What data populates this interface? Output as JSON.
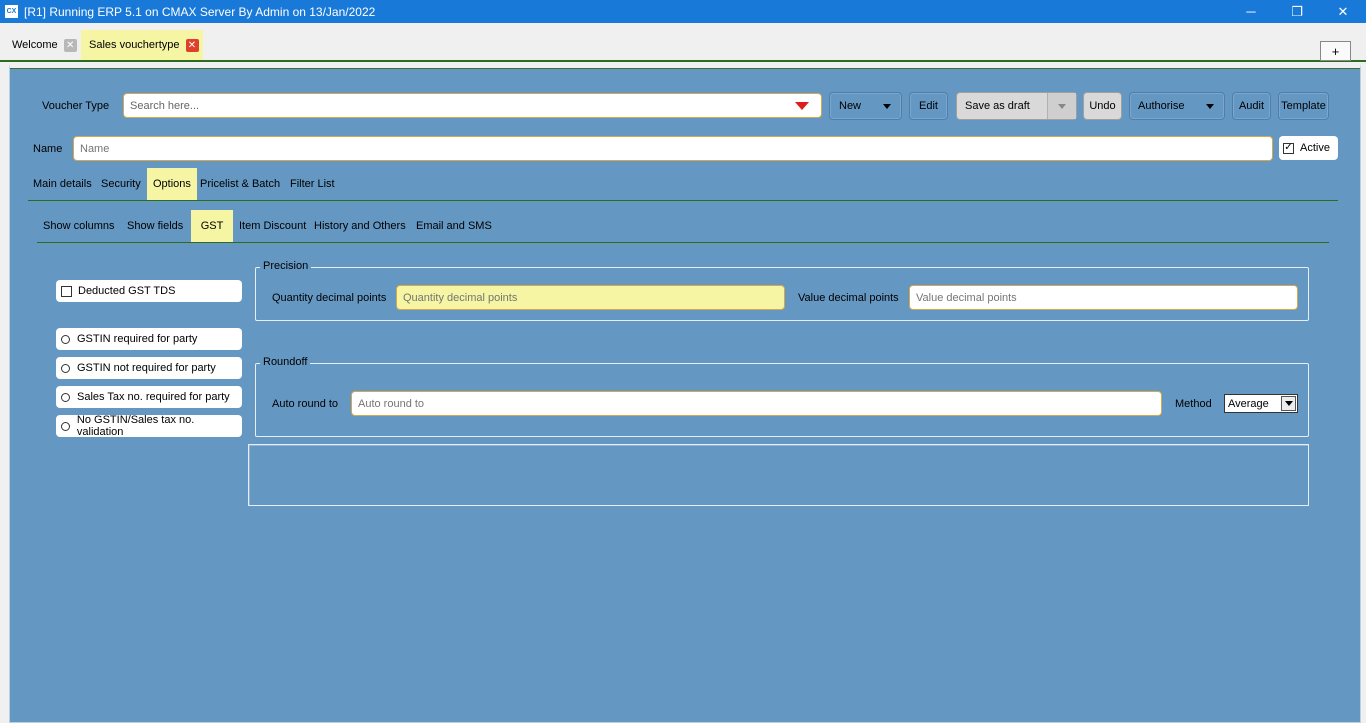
{
  "window": {
    "app_icon": "CX",
    "title": "[R1] Running ERP 5.1 on CMAX Server By Admin on 13/Jan/2022",
    "controls": {
      "minimize": "─",
      "restore": "❐",
      "close": "✕"
    }
  },
  "tabs": [
    {
      "label": "Welcome",
      "active": false
    },
    {
      "label": "Sales vouchertype",
      "active": true
    }
  ],
  "new_tab_label": "+",
  "toolbar": {
    "voucher_type_label": "Voucher Type",
    "search_placeholder": "Search here...",
    "new_label": "New",
    "edit_label": "Edit",
    "save_draft_label": "Save as draft",
    "undo_label": "Undo",
    "authorise_label": "Authorise",
    "audit_label": "Audit",
    "template_label": "Template"
  },
  "name_row": {
    "label": "Name",
    "placeholder": "Name",
    "active_label": "Active",
    "active_checked": true
  },
  "main_tabs": [
    "Main details",
    "Security",
    "Options",
    "Pricelist & Batch",
    "Filter List"
  ],
  "main_tab_active": "Options",
  "sub_tabs": [
    "Show columns",
    "Show fields",
    "GST",
    "Item Discount",
    "History and Others",
    "Email and SMS"
  ],
  "sub_tab_active": "GST",
  "gst": {
    "deducted_tds_label": "Deducted GST TDS",
    "radio_options": [
      "GSTIN required for party",
      "GSTIN not required for party",
      "Sales Tax no. required for party",
      "No GSTIN/Sales tax no. validation"
    ],
    "precision": {
      "title": "Precision",
      "qty_label": "Quantity decimal points",
      "qty_placeholder": "Quantity decimal points",
      "value_label": "Value decimal points",
      "value_placeholder": "Value decimal points"
    },
    "roundoff": {
      "title": "Roundoff",
      "auto_round_label": "Auto round to",
      "auto_round_placeholder": "Auto round to",
      "method_label": "Method",
      "method_value": "Average"
    }
  },
  "colors": {
    "titlebar": "#1979d8",
    "panel": "#6597c3",
    "highlight": "#f5f5a3",
    "divider": "#2e6b1f",
    "dropdown_arrow": "#e01b1b"
  }
}
